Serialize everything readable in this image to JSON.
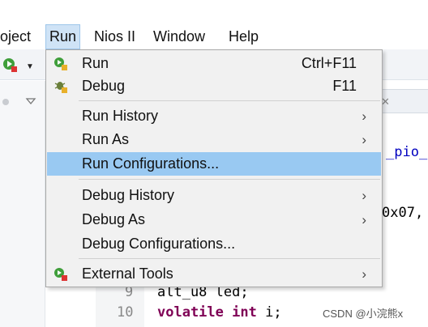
{
  "menubar": {
    "items": [
      {
        "label": "oject"
      },
      {
        "label": "Run"
      },
      {
        "label": "Nios II"
      },
      {
        "label": "Window"
      },
      {
        "label": "Help"
      }
    ]
  },
  "run_menu": {
    "run": {
      "label": "Run",
      "shortcut": "Ctrl+F11"
    },
    "debug": {
      "label": "Debug",
      "shortcut": "F11"
    },
    "run_history": {
      "label": "Run History",
      "arrow": "›"
    },
    "run_as": {
      "label": "Run As",
      "arrow": "›"
    },
    "run_configurations": {
      "label": "Run Configurations..."
    },
    "debug_history": {
      "label": "Debug History",
      "arrow": "›"
    },
    "debug_as": {
      "label": "Debug As",
      "arrow": "›"
    },
    "debug_configurations": {
      "label": "Debug Configurations..."
    },
    "external_tools": {
      "label": "External Tools",
      "arrow": "›"
    }
  },
  "editor": {
    "tab_close": "✕",
    "fragments": [
      "_pio_",
      "0x07,"
    ],
    "lines": [
      {
        "num": "9",
        "code": "alt_u8 led;"
      },
      {
        "num": "10",
        "keyword1": "volatile",
        "keyword2": "int",
        "rest": " i;"
      }
    ]
  },
  "watermark": "CSDN @小浣熊x",
  "colors": {
    "highlight": "#99c9f2",
    "menu_bg": "#f1f1f1",
    "keyword": "#7f0055"
  }
}
